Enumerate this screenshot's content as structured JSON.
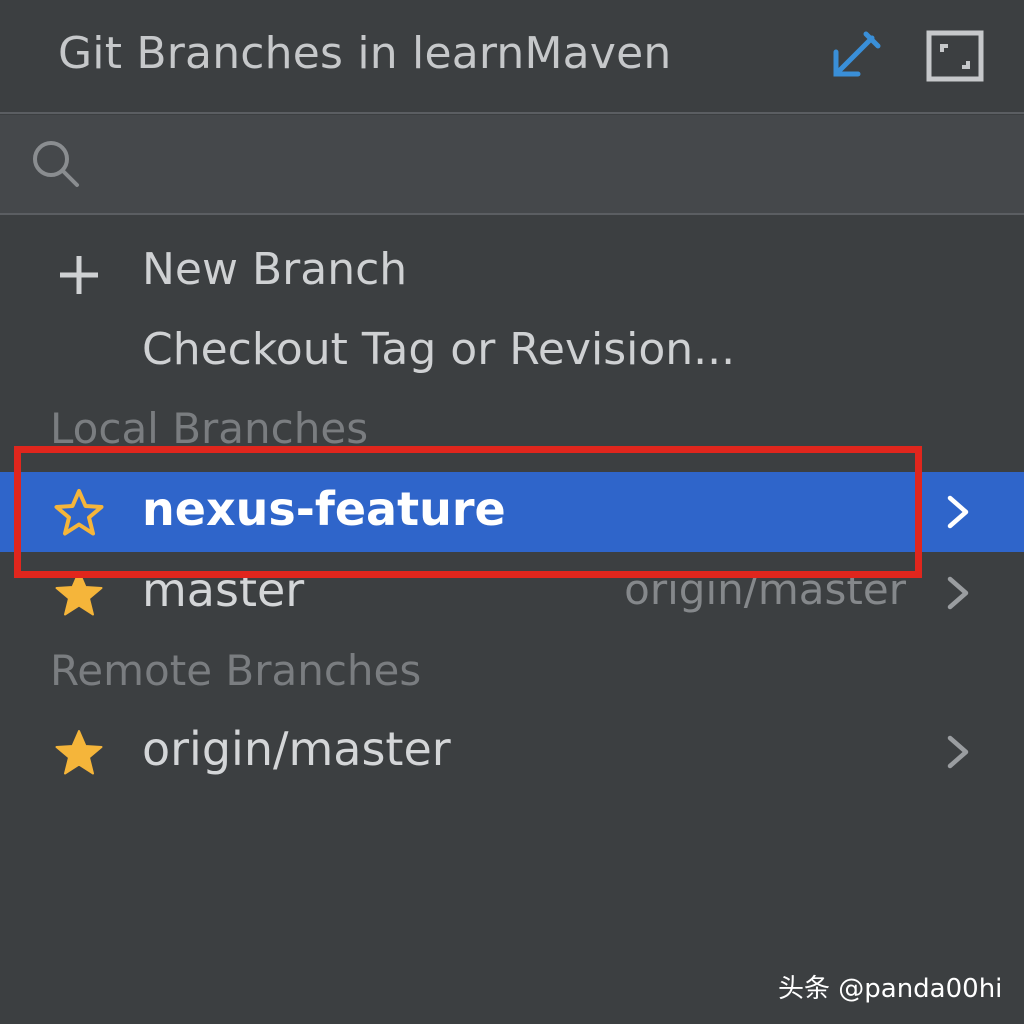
{
  "header": {
    "title": "Git Branches in learnMaven",
    "pin_icon": "pin-arrow-icon",
    "expand_icon": "expand-window-icon"
  },
  "search": {
    "placeholder": "",
    "value": "",
    "icon": "search-icon"
  },
  "actions": [
    {
      "label": "New Branch",
      "icon": "plus-icon"
    },
    {
      "label": "Checkout Tag or Revision...",
      "icon": ""
    }
  ],
  "local_branches": {
    "header": "Local Branches",
    "items": [
      {
        "name": "nexus-feature",
        "tracking": "",
        "favorite": false,
        "selected": true
      },
      {
        "name": "master",
        "tracking": "origin/master",
        "favorite": true,
        "selected": false
      }
    ]
  },
  "remote_branches": {
    "header": "Remote Branches",
    "items": [
      {
        "name": "origin/master",
        "tracking": "",
        "favorite": true,
        "selected": false
      }
    ]
  },
  "colors": {
    "background": "#3c3f41",
    "selection": "#2f65ca",
    "star": "#f5b53a",
    "highlight_box": "#e0261d",
    "pin_icon": "#3a8fd8"
  },
  "watermark": "头条 @panda00hi"
}
